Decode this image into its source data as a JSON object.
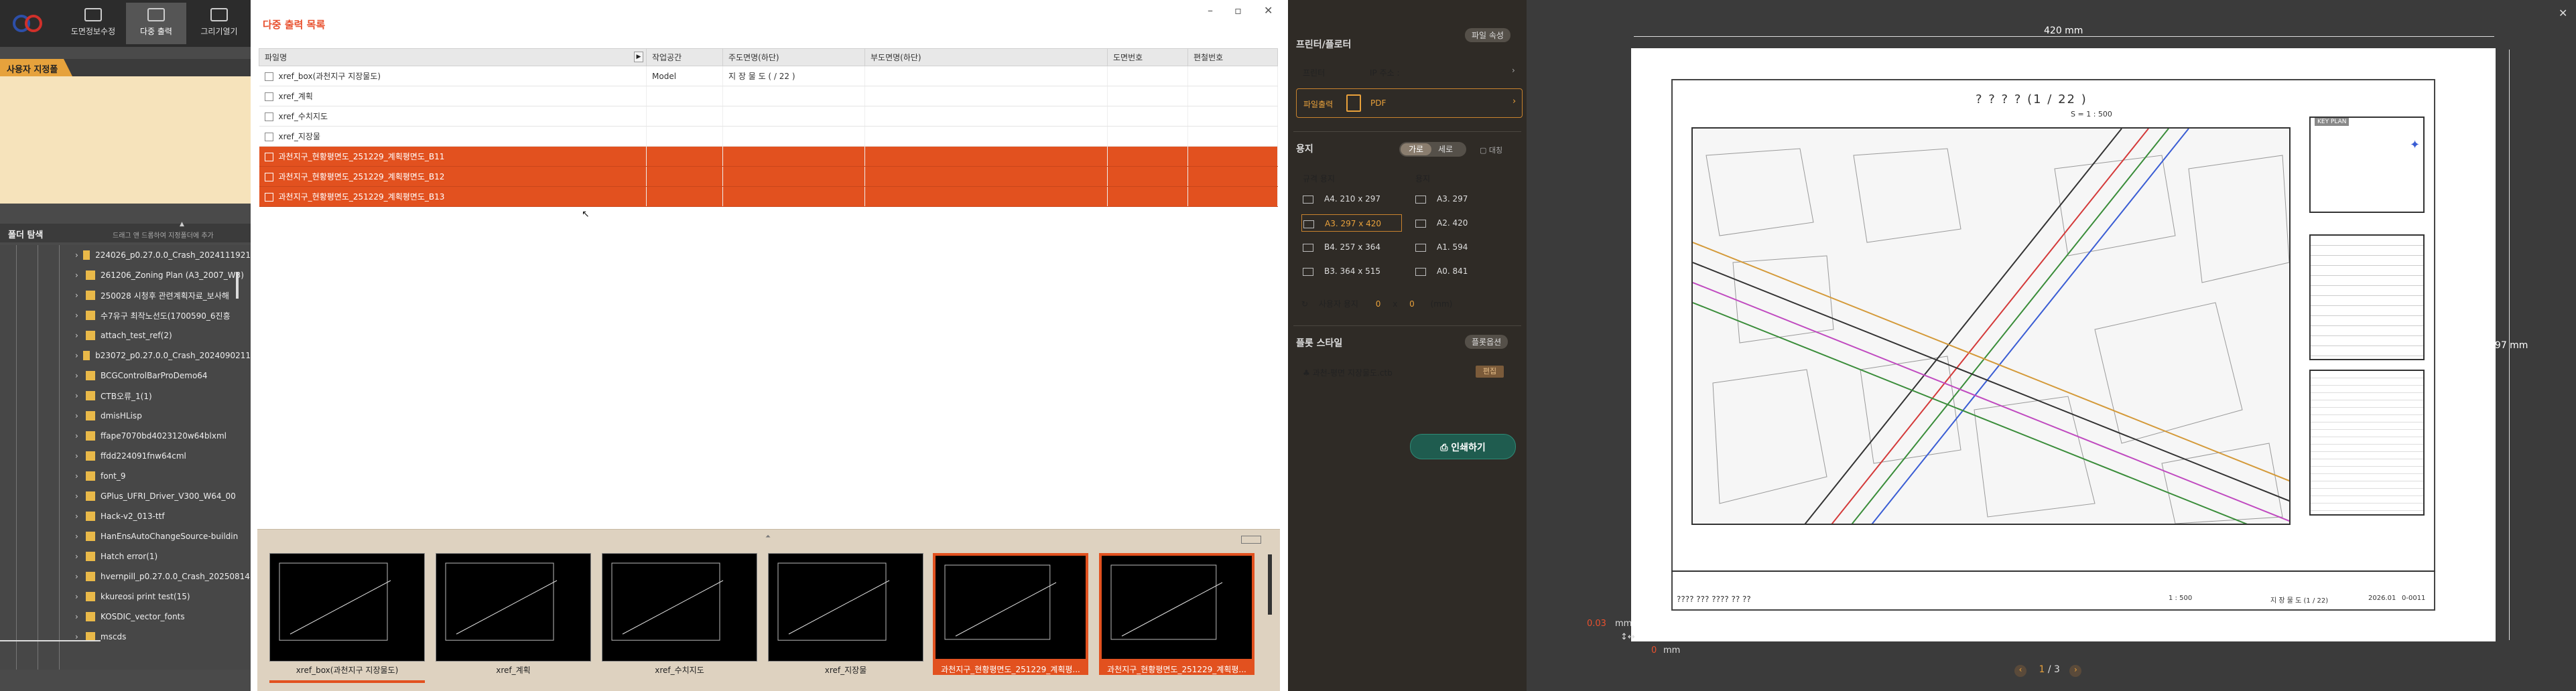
{
  "toolbar": {
    "btn1": "도면정보수정",
    "btn2": "다중 출력",
    "btn3": "그리기열기"
  },
  "favorites": {
    "tab": "사용자 지정폴더"
  },
  "folders": {
    "title": "폴더 탐색",
    "hint": "드래그 앤 드롭하여 지정폴더에 추가",
    "items": [
      "224026_p0.27.0.0_Crash_2024111921",
      "261206_Zoning Plan (A3_2007_W3)",
      "250028 시청후 관련계획자료_보사해",
      "수7유구 최작노선도(1700590_6진흥",
      "attach_test_ref(2)",
      "b23072_p0.27.0.0_Crash_2024090211",
      "BCGControlBarProDemo64",
      "CTB오류_1(1)",
      "dmisHLisp",
      "ffape7070bd4023120w64blxml",
      "ffdd224091fnw64cml",
      "font_9",
      "GPlus_UFRI_Driver_V300_W64_00",
      "Hack-v2_013-ttf",
      "HanEnsAutoChangeSource-buildin",
      "Hatch error(1)",
      "hvernpill_p0.27.0.0_Crash_20250814",
      "kkureosi print test(15)",
      "KOSDIC_vector_fonts",
      "mscds"
    ]
  },
  "main": {
    "title": "다중 출력 목록",
    "columns": [
      "파일명",
      "작업공간",
      "주도면명(하단)",
      "부도면명(하단)",
      "도면번호",
      "편철번호"
    ],
    "rows": [
      {
        "file": "xref_box(과천지구 지장물도)",
        "space": "Model",
        "main": "지 장 물 도 (    / 22 )",
        "sel": false
      },
      {
        "file": "xref_계획",
        "space": "",
        "main": "",
        "sel": false
      },
      {
        "file": "xref_수치지도",
        "space": "",
        "main": "",
        "sel": false
      },
      {
        "file": "xref_지장물",
        "space": "",
        "main": "",
        "sel": false
      },
      {
        "file": "과천지구_현황평면도_251229_계획평면도_B11",
        "space": "",
        "main": "",
        "sel": true
      },
      {
        "file": "과천지구_현황평면도_251229_계획평면도_B12",
        "space": "",
        "main": "",
        "sel": true
      },
      {
        "file": "과천지구_현황평면도_251229_계획평면도_B13",
        "space": "",
        "main": "",
        "sel": true
      }
    ],
    "thumbs": [
      "xref_box(과천지구 지장물도)",
      "xref_계획",
      "xref_수치지도",
      "xref_지장물",
      "과천지구_현황평면도_251229_계획평...",
      "과천지구_현황평면도_251229_계획평..."
    ]
  },
  "settings": {
    "printer_head": "프린터/플로터",
    "printer_pill": "파일 속성",
    "printer_label": "프린터",
    "printer_value": "IP 주소 :",
    "file_output": "파일출력",
    "file_type": "PDF",
    "paper_head": "용지",
    "orient_h": "가로",
    "orient_v": "세로",
    "fit": "대칭",
    "std_label": "규격 용지",
    "paper_label": "용지",
    "papers_left": [
      "A4. 210 x 297",
      "A3. 297 x 420",
      "B4. 257 x 364",
      "B3. 364 x 515"
    ],
    "papers_right": [
      "A3. 297",
      "A2. 420",
      "A1. 594",
      "A0. 841"
    ],
    "custom_label": "사용자 용지",
    "custom_w": "0",
    "custom_x": "x",
    "custom_h": "0",
    "custom_unit": "(mm)",
    "style_head": "플롯 스타일",
    "style_pill": "플롯옵션",
    "style_file": "과천-평면 지장물도.ctb",
    "style_btn": "편집",
    "print_btn": "인쇄하기"
  },
  "preview": {
    "width_dim": "420 mm",
    "height_dim": "297 mm",
    "offset_y": "0.03",
    "offset_unit": "mm",
    "offset_x": "0",
    "offset_x_unit": "mm",
    "page": "1",
    "page_total": "/ 3",
    "sheet_title": "? ? ? ?  (1     /  22 )",
    "sheet_scale": "S = 1 : 500",
    "key_plan": "KEY PLAN",
    "bottom_name": "???? ??? ???? ?? ??",
    "bottom_scale": "1 : 500",
    "bottom_dwg": "지 장 물 도 (1 / 22)",
    "bottom_date": "2026.01",
    "bottom_no": "0-0011",
    "accent": "#e2511f"
  }
}
